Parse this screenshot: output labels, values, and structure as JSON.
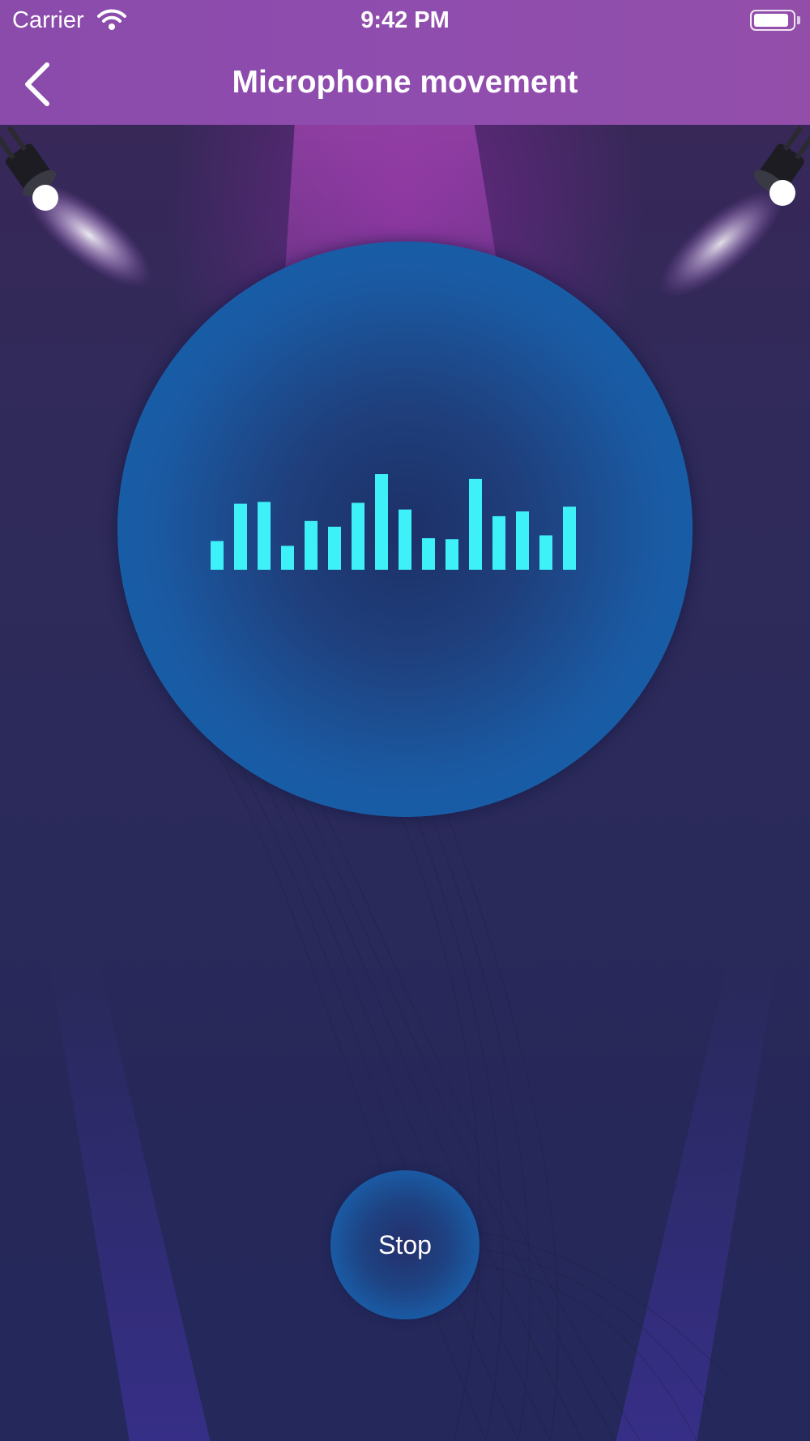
{
  "status_bar": {
    "carrier": "Carrier",
    "time": "9:42 PM",
    "wifi_icon": "wifi-icon",
    "battery_icon": "battery-icon"
  },
  "nav": {
    "title": "Microphone movement",
    "back_icon": "chevron-left-icon"
  },
  "meter": {
    "bar_color": "#3ef0f8",
    "bar_levels": [
      0.3,
      0.69,
      0.71,
      0.25,
      0.51,
      0.45,
      0.7,
      1.0,
      0.63,
      0.33,
      0.32,
      0.95,
      0.56,
      0.61,
      0.36,
      0.66
    ]
  },
  "controls": {
    "stop_label": "Stop"
  },
  "colors": {
    "nav_background": "#8f4dae",
    "background": "#26285a",
    "circle_blue": "#1a5aa3"
  }
}
